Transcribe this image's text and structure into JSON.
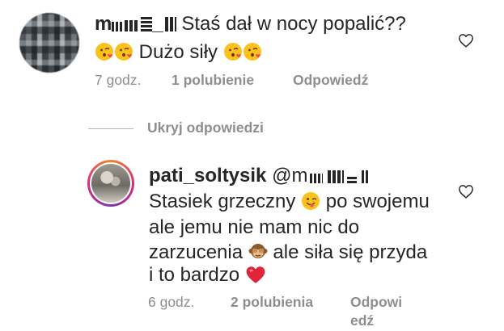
{
  "comments": [
    {
      "username": "m▪▪▪ ▪▪▪_ ▪▪▪",
      "text_line1": " Staś dał w nocy popalić??",
      "text_line2": " Dużo siły ",
      "time": "7 godz.",
      "likes": "1 polubienie",
      "reply": "Odpowiedź"
    },
    {
      "username": "pati_soltysik",
      "mention": "@m▪▪▪▪ ▪▪▪",
      "text_lines": [
        "Stasiek grzeczny ",
        "ale jemu nie mam nic do",
        "zarzucenia ",
        "i to bardzo "
      ],
      "text_after_emoji1": " po swojemu",
      "text_after_emoji2": " ale siła się przyda",
      "time": "6 godz.",
      "likes": "2 polubienia",
      "reply_line1": "Odpowi",
      "reply_line2": "edź"
    }
  ],
  "hide_replies": "Ukryj odpowiedzi",
  "icons": {
    "kiss": "kissing-heart-emoji",
    "wink": "winking-tongue-emoji",
    "monkey": "see-no-evil-monkey-emoji",
    "heart": "red-heart-emoji",
    "like": "heart-outline-icon"
  },
  "colors": {
    "text": "#262626",
    "muted": "#8e8e8e",
    "heart": "#ed4956"
  }
}
